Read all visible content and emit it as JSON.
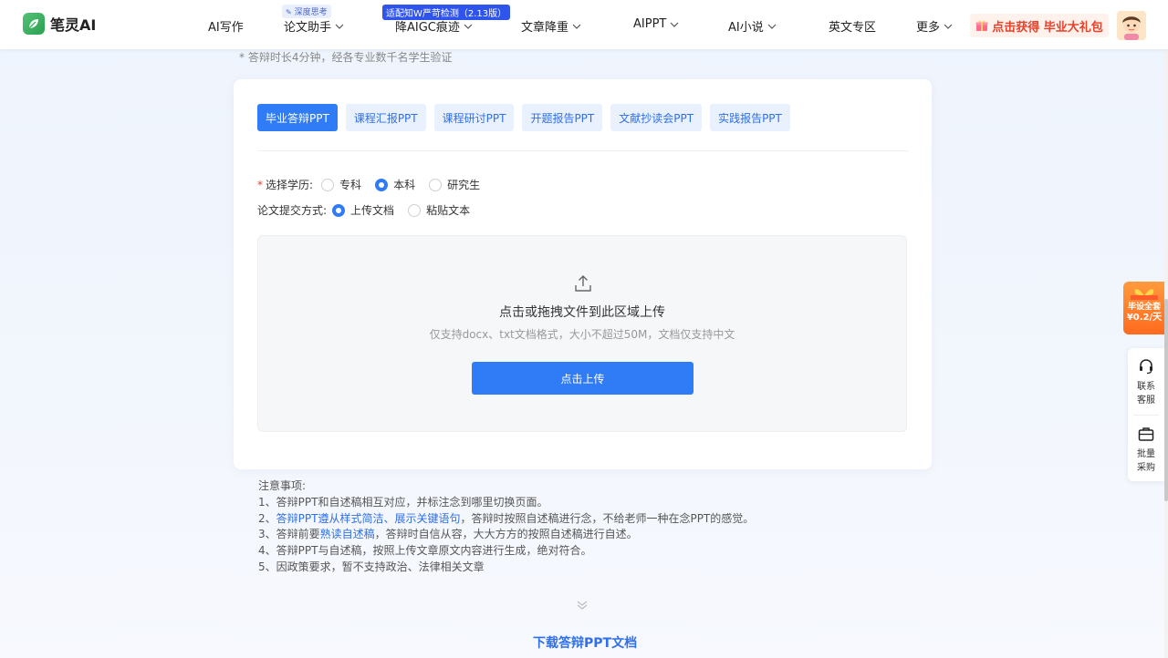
{
  "brand": {
    "name": "笔灵AI",
    "accent": "#2f7cf6",
    "logo_color": "#3bb162"
  },
  "nav": {
    "items": [
      {
        "label": "AI写作",
        "has_dropdown": false
      },
      {
        "label": "论文助手",
        "has_dropdown": true,
        "badge": "深度思考"
      },
      {
        "label": "降AIGC痕迹",
        "has_dropdown": true,
        "badge": "适配知W严苛检测（2.13版）"
      },
      {
        "label": "文章降重",
        "has_dropdown": true
      },
      {
        "label": "AIPPT",
        "has_dropdown": true
      },
      {
        "label": "AI小说",
        "has_dropdown": true
      },
      {
        "label": "英文专区",
        "has_dropdown": false
      },
      {
        "label": "更多",
        "has_dropdown": true
      }
    ],
    "gift_button": "点击获得 毕业大礼包"
  },
  "top_note": "* 答辩时长4分钟，经各专业数千名学生验证",
  "tabs": [
    {
      "label": "毕业答辩PPT",
      "active": true
    },
    {
      "label": "课程汇报PPT",
      "active": false
    },
    {
      "label": "课程研讨PPT",
      "active": false
    },
    {
      "label": "开题报告PPT",
      "active": false
    },
    {
      "label": "文献抄读会PPT",
      "active": false
    },
    {
      "label": "实践报告PPT",
      "active": false
    }
  ],
  "form": {
    "education": {
      "label": "选择学历:",
      "required_mark": "*",
      "options": [
        {
          "label": "专科",
          "selected": false
        },
        {
          "label": "本科",
          "selected": true
        },
        {
          "label": "研究生",
          "selected": false
        }
      ]
    },
    "submit_method": {
      "label": "论文提交方式:",
      "options": [
        {
          "label": "上传文档",
          "selected": true
        },
        {
          "label": "粘贴文本",
          "selected": false
        }
      ]
    }
  },
  "upload": {
    "title": "点击或拖拽文件到此区域上传",
    "hint": "仅支持docx、txt文档格式，大小不超过50M，文档仅支持中文",
    "button": "点击上传"
  },
  "notes": {
    "title": "注意事项:",
    "line1": "1、答辩PPT和自述稿相互对应，并标注念到哪里切换页面。",
    "line2_prefix": "2、",
    "line2_highlight": "答辩PPT遵从样式简洁、展示关键语句",
    "line2_suffix": "，答辩时按照自述稿进行念，不给老师一种在念PPT的感觉。",
    "line3_prefix": "3、答辩前要",
    "line3_highlight": "熟读自述稿",
    "line3_suffix": "，答辩时自信从容，大大方方的按照自述稿进行自述。",
    "line4": "4、答辩PPT与自述稿，按照上传文章原文内容进行生成，绝对符合。",
    "line5": "5、因政策要求，暂不支持政治、法律相关文章"
  },
  "download_link": "下载答辩PPT文档",
  "side": {
    "promo_line1": "毕设全套",
    "promo_line2": "¥0.2/天",
    "contact": [
      "联系",
      "客服"
    ],
    "bulk": [
      "批量",
      "采购"
    ]
  }
}
